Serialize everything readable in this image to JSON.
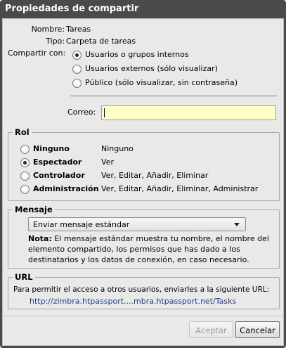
{
  "window": {
    "title": "Propiedades de compartir"
  },
  "info": {
    "name_label": "Nombre:",
    "name_value": "Tareas",
    "type_label": "Tipo:",
    "type_value": "Carpeta de tareas"
  },
  "share_with": {
    "label": "Compartir con:",
    "options": [
      {
        "label": "Usuarios o grupos internos",
        "checked": true
      },
      {
        "label": "Usuarios externos (sólo visualizar)",
        "checked": false
      },
      {
        "label": "Público (sólo visualizar, sin contraseña)",
        "checked": false
      }
    ]
  },
  "email": {
    "label": "Correo:",
    "value": ""
  },
  "role": {
    "legend": "Rol",
    "options": [
      {
        "name": "Ninguno",
        "desc": "Ninguno",
        "checked": false
      },
      {
        "name": "Espectador",
        "desc": "Ver",
        "checked": true
      },
      {
        "name": "Controlador",
        "desc": "Ver, Editar, Añadir, Eliminar",
        "checked": false
      },
      {
        "name": "Administración",
        "desc": "Ver, Editar, Añadir, Eliminar, Administrar",
        "checked": false
      }
    ]
  },
  "message": {
    "legend": "Mensaje",
    "selected": "Enviar mensaje estándar",
    "note_label": "Nota:",
    "note_line1": "El mensaje estándar muestra tu nombre, el nombre del",
    "note_line2": "elemento compartido, los permisos que has dado a los",
    "note_line3": "destinatarios y los datos de conexión, en caso necesario."
  },
  "url_section": {
    "legend": "URL",
    "text": "Para permitir el acceso a otros usuarios, enviarles a la siguiente URL:",
    "link": "http://zimbra.htpassport....mbra.htpassport.net/Tasks"
  },
  "buttons": {
    "accept": "Aceptar",
    "cancel": "Cancelar"
  }
}
